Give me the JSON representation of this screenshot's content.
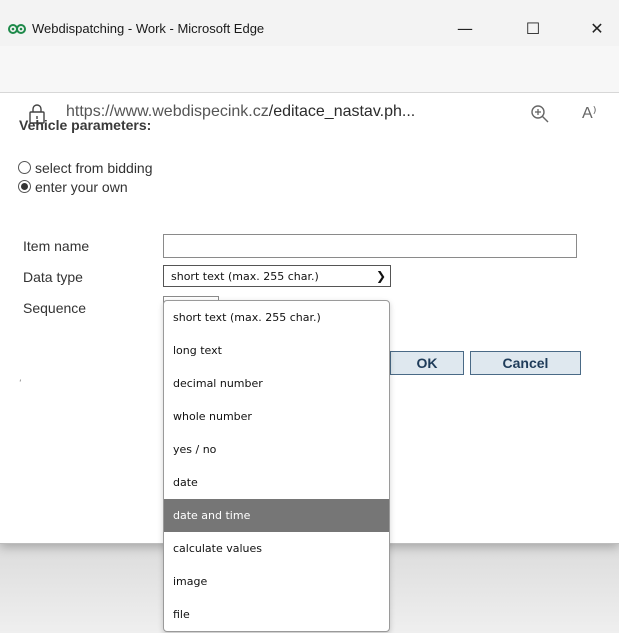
{
  "window": {
    "title": "Webdispatching - Work - Microsoft Edge",
    "minimize_glyph": "—",
    "maximize_glyph": "☐",
    "close_glyph": "✕"
  },
  "browser": {
    "url_host": "https://www.webdispecink.cz",
    "url_path": "/editace_nastav.ph...",
    "zoom_icon": "zoom-in-icon",
    "read_aloud_label": "A⁾"
  },
  "form": {
    "section_title": "Vehicle parameters:",
    "radio_options": [
      {
        "label": "select from bidding",
        "checked": false
      },
      {
        "label": "enter your own",
        "checked": true
      }
    ],
    "labels": {
      "item_name": "Item name",
      "data_type": "Data type",
      "sequence": "Sequence"
    },
    "item_name_value": "",
    "data_type_selected": "short text (max. 255 char.)",
    "sequence_value": "",
    "ok_label": "OK",
    "cancel_label": "Cancel",
    "small_mark": "ʻ"
  },
  "dropdown": {
    "options": [
      "short text (max. 255 char.)",
      "long text",
      "decimal number",
      "whole number",
      "yes / no",
      "date",
      "date and time",
      "calculate values",
      "image",
      "file"
    ],
    "highlighted": "date and time"
  },
  "colors": {
    "button_border": "#4a6a86",
    "button_text": "#1f3c5a",
    "highlight": "#767676",
    "app_icon": "#1e8a4a"
  }
}
